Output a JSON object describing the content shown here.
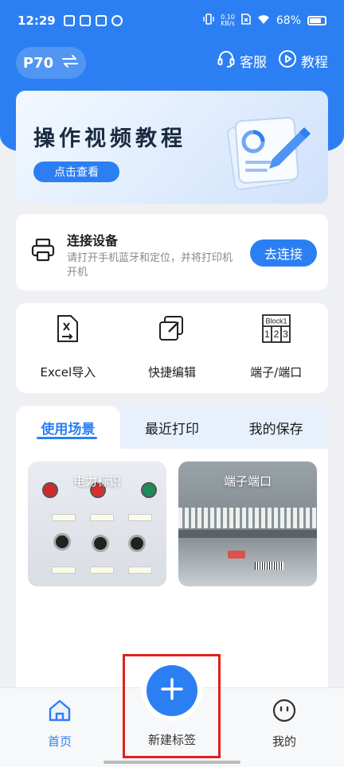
{
  "status_bar": {
    "time": "12:29",
    "net_speed_top": "0.10",
    "net_speed_bottom": "KB/s",
    "battery": "68%"
  },
  "header": {
    "device": "P70",
    "service_label": "客服",
    "tutorial_label": "教程"
  },
  "banner": {
    "title": "操作视频教程",
    "button": "点击查看"
  },
  "connect": {
    "title": "连接设备",
    "description": "请打开手机蓝牙和定位，并将打印机开机",
    "button": "去连接"
  },
  "tools": [
    {
      "label": "Excel导入",
      "icon": "excel-import-icon"
    },
    {
      "label": "快捷编辑",
      "icon": "quick-edit-icon"
    },
    {
      "label": "端子/端口",
      "icon": "terminal-port-icon"
    }
  ],
  "terminal_icon_text": {
    "top": "Block1",
    "cells": [
      "1",
      "2",
      "3"
    ]
  },
  "tabs": [
    {
      "label": "使用场景",
      "active": true
    },
    {
      "label": "最近打印",
      "active": false
    },
    {
      "label": "我的保存",
      "active": false
    }
  ],
  "scenes": [
    {
      "label": "电力标识"
    },
    {
      "label": "端子端口"
    }
  ],
  "bottom_nav": {
    "home": "首页",
    "new_label": "新建标签",
    "mine": "我的"
  },
  "colors": {
    "accent": "#2c7ff2",
    "highlight": "#e0201c"
  }
}
